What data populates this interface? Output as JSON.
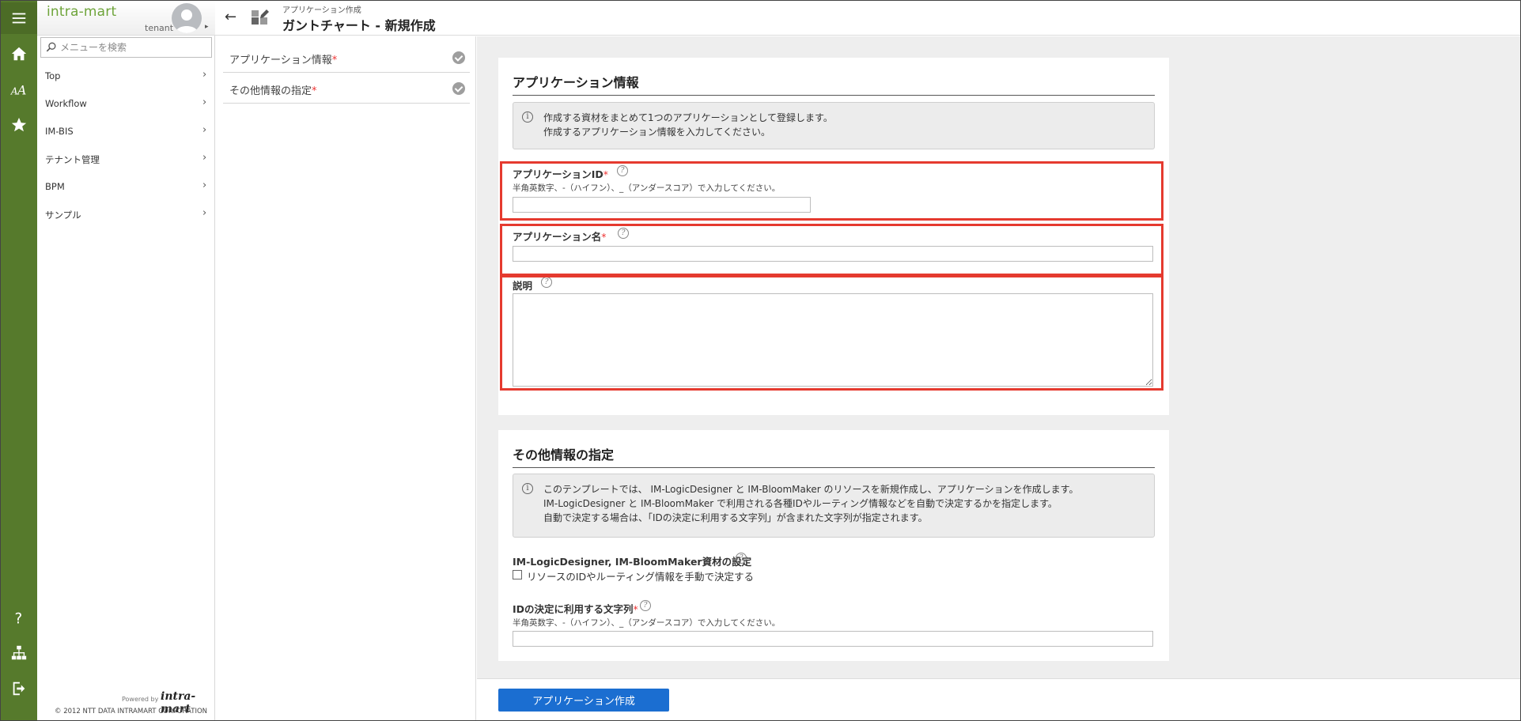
{
  "brand": {
    "logo_text": "intra-mart",
    "tenant": "tenant"
  },
  "search": {
    "placeholder": "メニューを検索"
  },
  "rail": {
    "icons": [
      "menu-icon",
      "home-icon",
      "font-size-icon",
      "star-icon",
      "help-icon",
      "sitemap-icon",
      "logout-icon"
    ],
    "color": "#567a2c"
  },
  "menu": {
    "items": [
      {
        "label": "Top"
      },
      {
        "label": "Workflow"
      },
      {
        "label": "IM-BIS"
      },
      {
        "label": "テナント管理"
      },
      {
        "label": "BPM"
      },
      {
        "label": "サンプル"
      }
    ],
    "powered_by": "Powered by",
    "powered_logo": "intra-mart",
    "copyright": "© 2012 NTT DATA INTRAMART CORPORATION"
  },
  "header": {
    "breadcrumb": "アプリケーション作成",
    "title": "ガントチャート - 新規作成"
  },
  "steps": [
    {
      "label": "アプリケーション情報",
      "required": "*"
    },
    {
      "label": "その他情報の指定",
      "required": "*"
    }
  ],
  "app_info": {
    "title": "アプリケーション情報",
    "info_line1": "作成する資材をまとめて1つのアプリケーションとして登録します。",
    "info_line2": "作成するアプリケーション情報を入力してください。",
    "app_id_label": "アプリケーションID",
    "app_id_required": "*",
    "app_id_hint": "半角英数字、-（ハイフン）、_（アンダースコア）で入力してください。",
    "app_id_value": "",
    "app_name_label": "アプリケーション名",
    "app_name_required": "*",
    "app_name_value": "",
    "desc_label": "説明",
    "desc_value": ""
  },
  "other_info": {
    "title": "その他情報の指定",
    "info_line1": "このテンプレートでは、 IM-LogicDesigner と IM-BloomMaker のリソースを新規作成し、アプリケーションを作成します。",
    "info_line2": "IM-LogicDesigner と IM-BloomMaker で利用される各種IDやルーティング情報などを自動で決定するかを指定します。",
    "info_line3": "自動で決定する場合は、「IDの決定に利用する文字列」が含まれた文字列が指定されます。",
    "settings_label": "IM-LogicDesigner, IM-BloomMaker資材の設定",
    "manual_checkbox_label": "リソースのIDやルーティング情報を手動で決定する",
    "manual_checked": false,
    "id_string_label": "IDの決定に利用する文字列",
    "id_string_required": "*",
    "id_string_hint": "半角英数字、-（ハイフン）、_（アンダースコア）で入力してください。",
    "id_string_value": ""
  },
  "footer": {
    "create_button": "アプリケーション作成"
  },
  "colors": {
    "primary": "#1b6ed1",
    "highlight": "#e53a2f",
    "brand_green": "#6ea43a",
    "required": "#e33333"
  }
}
